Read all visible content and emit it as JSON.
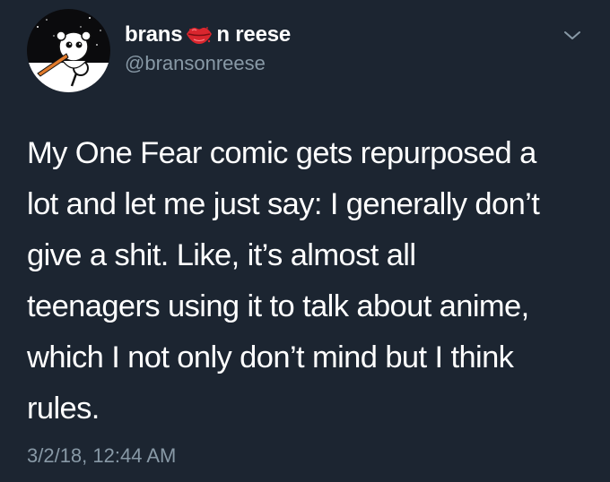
{
  "tweet": {
    "display_name_part1": "brans",
    "display_name_part2": "n reese",
    "name_emoji": "lips-icon",
    "handle": "@bransonreese",
    "body_lines": [
      "My One Fear comic gets repurposed a",
      "lot and let me just say: I generally don’t",
      "give a shit. Like, it’s almost all",
      "teenagers using it to talk about anime,",
      "which I not only don’t mind but I think",
      "rules."
    ],
    "timestamp": "3/2/18, 12:44 AM"
  },
  "colors": {
    "background": "#1c2531",
    "text_primary": "#ffffff",
    "text_secondary": "#8899a6",
    "lips": "#d9262e"
  },
  "icons": {
    "avatar": "avatar",
    "menu": "chevron-down-icon"
  }
}
